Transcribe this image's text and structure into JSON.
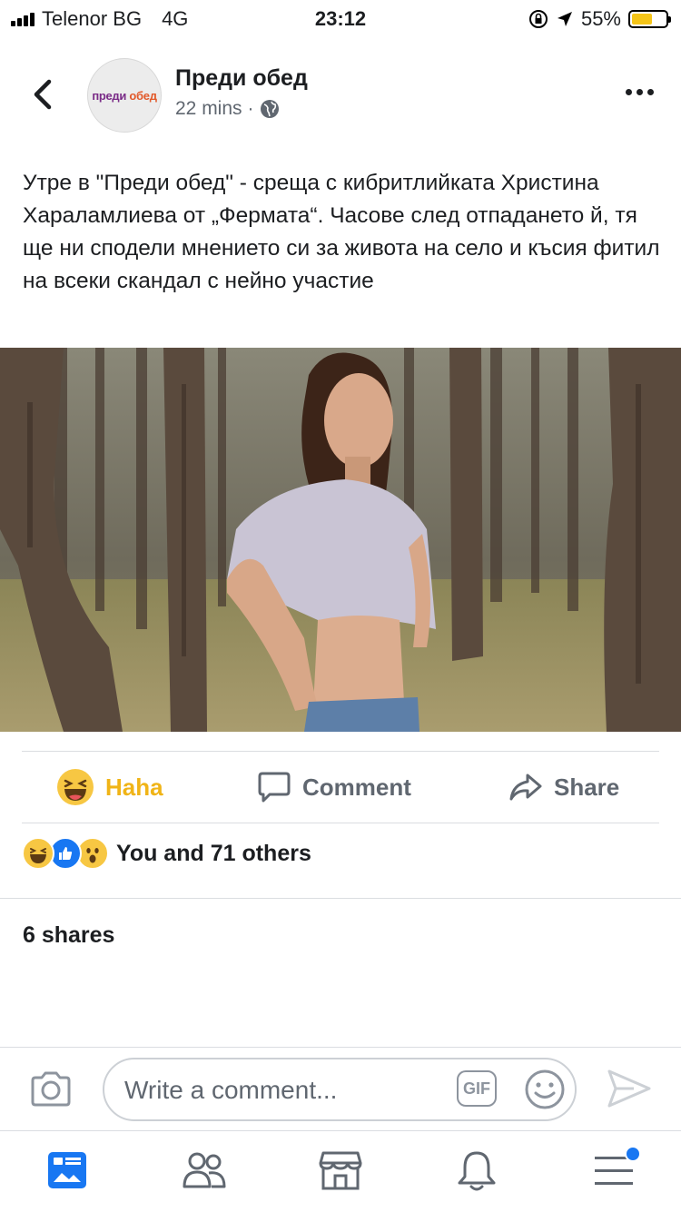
{
  "status_bar": {
    "carrier": "Telenor BG",
    "network": "4G",
    "time": "23:12",
    "battery": "55%"
  },
  "header": {
    "page_name": "Преди обед",
    "time_ago": "22 mins",
    "separator": "·",
    "avatar_logo_a": "преди",
    "avatar_logo_b": "обед"
  },
  "post": {
    "text": "Утре в \"Преди обед\" - среща с кибритлийката Христина Хараламлиева от „Фермата“. Часове след отпадането й, тя ще ни сподели мнението си за живота на село и късия фитил на всеки скандал с нейно участие"
  },
  "actions": {
    "haha_label": "Haha",
    "comment_label": "Comment",
    "share_label": "Share"
  },
  "reactions": {
    "summary": "You and 71 others"
  },
  "shares": {
    "count_text": "6 shares"
  },
  "composer": {
    "placeholder": "Write a comment...",
    "gif_label": "GIF"
  },
  "colors": {
    "accent": "#1877f2",
    "haha": "#f0b417",
    "text_secondary": "#606770"
  }
}
